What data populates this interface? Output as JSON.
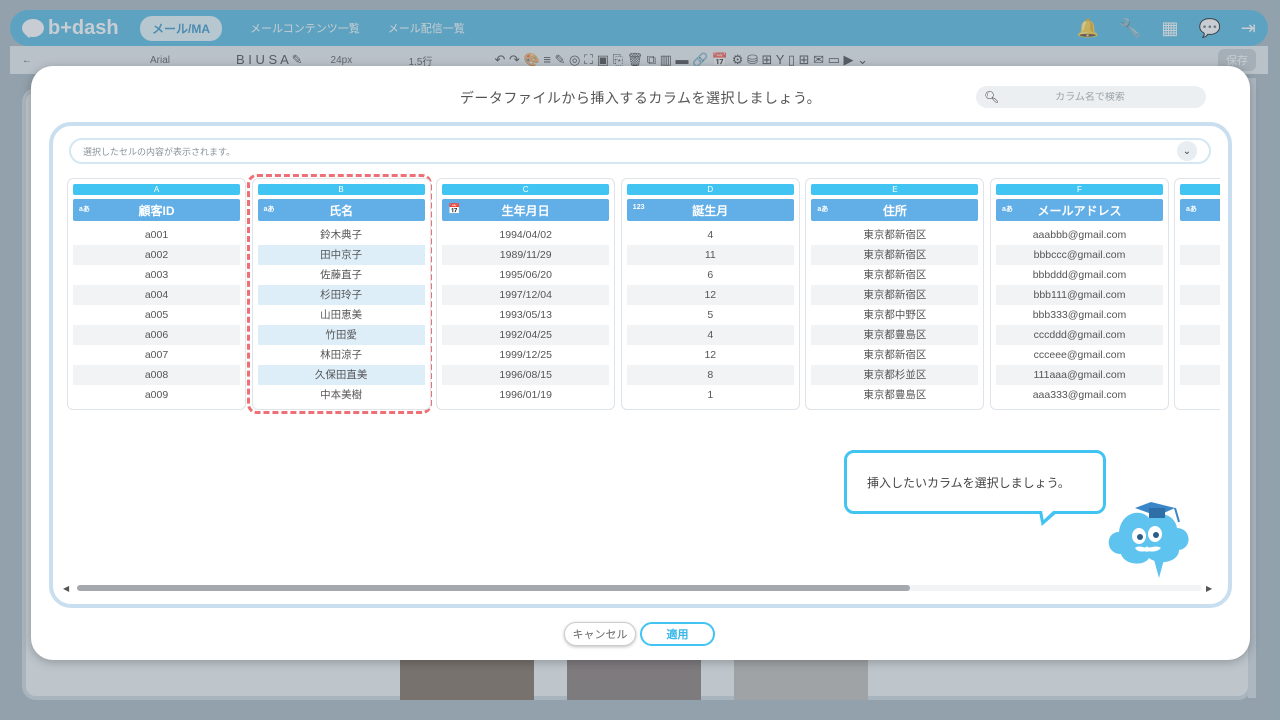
{
  "app": {
    "logo_text": "b+dash",
    "nav_active": "メール/MA",
    "nav_items": [
      "メールコンテンツ一覧",
      "メール配信一覧"
    ],
    "header_icons": [
      "bell-icon",
      "wrench-icon",
      "grid-icon",
      "chat-icon",
      "logout-icon"
    ]
  },
  "toolbar": {
    "font": "Arial",
    "font_size": "24px",
    "line_height": "1.5行",
    "save_label": "保存"
  },
  "modal": {
    "title": "データファイルから挿入するカラムを選択しましょう。",
    "search_placeholder": "カラム名で検索",
    "cell_preview_placeholder": "選択したセルの内容が表示されます。",
    "columns": [
      {
        "letter": "A",
        "name": "顧客ID",
        "type_icon": "aあ",
        "selected": false,
        "values": [
          "a001",
          "a002",
          "a003",
          "a004",
          "a005",
          "a006",
          "a007",
          "a008",
          "a009"
        ]
      },
      {
        "letter": "B",
        "name": "氏名",
        "type_icon": "aあ",
        "selected": true,
        "values": [
          "鈴木典子",
          "田中京子",
          "佐藤直子",
          "杉田玲子",
          "山田恵美",
          "竹田愛",
          "林田涼子",
          "久保田直美",
          "中本美樹"
        ]
      },
      {
        "letter": "C",
        "name": "生年月日",
        "type_icon": "📅",
        "selected": false,
        "values": [
          "1994/04/02",
          "1989/11/29",
          "1995/06/20",
          "1997/12/04",
          "1993/05/13",
          "1992/04/25",
          "1999/12/25",
          "1996/08/15",
          "1996/01/19"
        ]
      },
      {
        "letter": "D",
        "name": "誕生月",
        "type_icon": "123",
        "selected": false,
        "values": [
          "4",
          "11",
          "6",
          "12",
          "5",
          "4",
          "12",
          "8",
          "1"
        ]
      },
      {
        "letter": "E",
        "name": "住所",
        "type_icon": "aあ",
        "selected": false,
        "values": [
          "東京都新宿区",
          "東京都新宿区",
          "東京都新宿区",
          "東京都新宿区",
          "東京都中野区",
          "東京都豊島区",
          "東京都新宿区",
          "東京都杉並区",
          "東京都豊島区"
        ]
      },
      {
        "letter": "F",
        "name": "メールアドレス",
        "type_icon": "aあ",
        "selected": false,
        "values": [
          "aaabbb@gmail.com",
          "bbbccc@gmail.com",
          "bbbddd@gmail.com",
          "bbb111@gmail.com",
          "bbb333@gmail.com",
          "cccddd@gmail.com",
          "ccceee@gmail.com",
          "111aaa@gmail.com",
          "aaa333@gmail.com"
        ]
      }
    ],
    "tip_text": "挿入したいカラムを選択しましょう。",
    "cancel_label": "キャンセル",
    "apply_label": "適用"
  }
}
